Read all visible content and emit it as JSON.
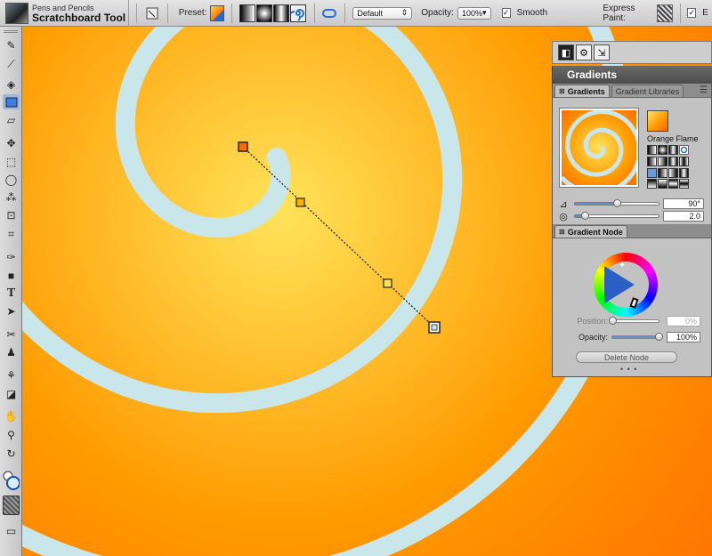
{
  "brush": {
    "category": "Pens and Pencils",
    "variant": "Scratchboard Tool"
  },
  "property_bar": {
    "preset_label": "Preset:",
    "blend_value": "Default",
    "opacity_label": "Opacity:",
    "opacity_value": "100%",
    "smooth_label": "Smooth",
    "smooth_checked": "✓",
    "express_label": "Express Paint:",
    "extra_checked": "✓",
    "extra_label": "E"
  },
  "panel_strip": {
    "icons": [
      "gradient-swatch-icon",
      "gear-icon",
      "link-icon"
    ]
  },
  "gradients_panel": {
    "title": "Gradients",
    "tabs": [
      "Gradients",
      "Gradient Libraries"
    ],
    "gradient_name": "Orange Flame",
    "angle_value": "90°",
    "angle_fraction": 0.5,
    "repeat_value": "2.0",
    "repeat_fraction": 0.12
  },
  "node_panel": {
    "tab": "Gradient Node",
    "position_label": "Position:",
    "position_value": "0%",
    "opacity_label": "Opacity:",
    "opacity_value": "100%",
    "opacity_fraction": 1.0,
    "delete_label": "Delete Node",
    "dots": "• • •"
  },
  "colors": {
    "gradient_light": "#ffe85c",
    "gradient_mid": "#ffa100",
    "gradient_dark": "#ff6000",
    "spiral_gap": "#c9e6ea",
    "accent": "#3a74c9"
  },
  "toolbox": {
    "tools": [
      "brush-tool-icon",
      "dropper-icon",
      "paint-bucket-icon",
      "rectangle-fill-icon",
      "eraser-icon",
      "transform-icon",
      "rect-select-icon",
      "lasso-icon",
      "magic-wand-icon",
      "crop-icon",
      "crop-tool-icon",
      "pen-icon",
      "shape-icon",
      "text-icon",
      "shape-select-icon",
      "cloner-icon",
      "rubber-stamp-icon",
      "mirror-icon",
      "divine-proportion-icon",
      "grabber-icon",
      "magnifier-icon",
      "rotate-page-icon",
      "color-swatch-icon",
      "paper-texture-icon",
      "screen-mode-icon"
    ]
  }
}
